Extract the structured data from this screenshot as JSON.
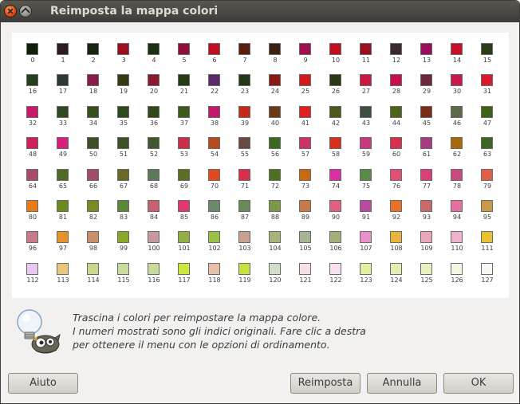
{
  "window": {
    "title": "Reimposta la mappa colori"
  },
  "palette": {
    "colors": [
      "#0f1f0a",
      "#2d1a24",
      "#16260e",
      "#9c0f20",
      "#1a3010",
      "#8f0f3a",
      "#c01020",
      "#5a1e0e",
      "#3b2210",
      "#a01050",
      "#c00f1f",
      "#9a1020",
      "#3a2a2c",
      "#9a0d5a",
      "#c80f2a",
      "#2a3e1c",
      "#24401c",
      "#2d3a36",
      "#8c1a4a",
      "#3a3a12",
      "#8a1a2e",
      "#243c14",
      "#5a2a6a",
      "#243818",
      "#8a1a14",
      "#d01a1e",
      "#2a3818",
      "#c81a40",
      "#c8104a",
      "#6a2a3a",
      "#c81a4a",
      "#d81a2e",
      "#c81a6a",
      "#2e4a22",
      "#36521c",
      "#2e4a1c",
      "#2e4a1c",
      "#3e5a1c",
      "#c4186a",
      "#c42a1a",
      "#6a3a18",
      "#e0201e",
      "#4a5a1c",
      "#3e5040",
      "#4a6418",
      "#7a2e1a",
      "#5a6a4a",
      "#3e6216",
      "#d0205a",
      "#d8207a",
      "#3e5028",
      "#3e5026",
      "#3e5830",
      "#cc2e4a",
      "#b84a20",
      "#6a4a40",
      "#386a20",
      "#d0306a",
      "#d8301e",
      "#c83880",
      "#d8304a",
      "#a83a80",
      "#a8680e",
      "#3e6622",
      "#a84c6a",
      "#4e6a24",
      "#a04c6a",
      "#6a6a26",
      "#5a7a5a",
      "#5a6e26",
      "#e04a1e",
      "#d8304a",
      "#4e7020",
      "#c86a14",
      "#d830a0",
      "#5a8a4a",
      "#e05070",
      "#d8407a",
      "#c84a80",
      "#e0604a",
      "#e87a1a",
      "#6a8a20",
      "#7a8a22",
      "#5a8a38",
      "#c86070",
      "#e03a70",
      "#6a8a6a",
      "#6a8a5a",
      "#7a9a4a",
      "#c87a4a",
      "#e06080",
      "#b84aa0",
      "#e8722a",
      "#c86a6a",
      "#e870a0",
      "#c89a4a",
      "#c87a8a",
      "#e8902a",
      "#c8906a",
      "#8aa828",
      "#c898a0",
      "#92b040",
      "#9ac048",
      "#c8a090",
      "#a4b47a",
      "#a4b494",
      "#a4b07a",
      "#e890c8",
      "#e8b43a",
      "#e8a8b8",
      "#f0b0d0",
      "#e8c030",
      "#e8c8f0",
      "#e8c878",
      "#c8d88a",
      "#c8dc9c",
      "#c8dc9a",
      "#d0e83a",
      "#e8c0a8",
      "#c8e040",
      "#d0e0c8",
      "#f8e0e0",
      "#f8e0f0",
      "#e0f0a0",
      "#e0f0b0",
      "#e8f0c0",
      "#f0f8e0",
      "#f8f8f0"
    ]
  },
  "hint": {
    "icon": "gimp-tip-icon",
    "lines": [
      "Trascina i colori per reimpostare la mappa colore.",
      "I numeri mostrati sono gli indici originali. Fare clic a destra",
      "per ottenere il menu con le opzioni di ordinamento."
    ]
  },
  "buttons": {
    "help": "Aiuto",
    "reset": "Reimposta",
    "cancel": "Annulla",
    "ok": "OK"
  }
}
